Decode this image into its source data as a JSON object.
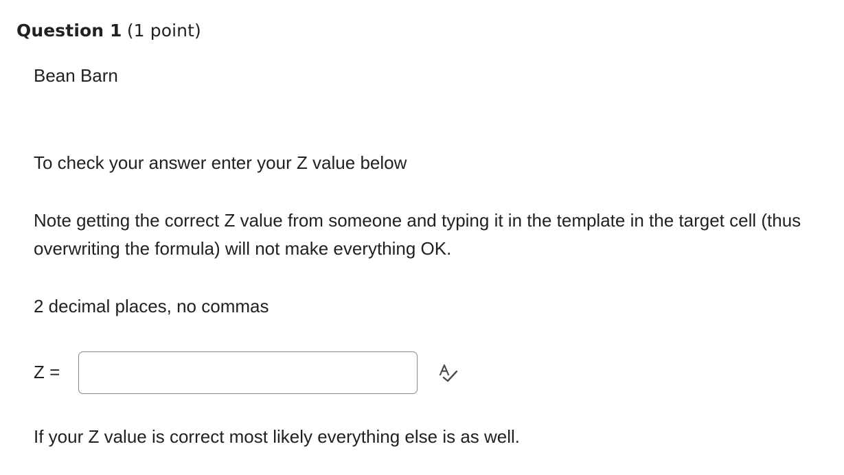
{
  "question": {
    "title": "Question 1",
    "points": "(1 point)"
  },
  "body": {
    "subject": "Bean Barn",
    "check_instruction": "To check your answer enter your Z value below",
    "note": "Note getting the correct Z value from someone and typing it in the template in the target cell (thus overwriting the formula) will not make everything OK.",
    "format_hint": "2 decimal places, no commas",
    "footer": "If your Z value is correct most likely everything else is as well."
  },
  "answer": {
    "label": "Z =",
    "value": "",
    "placeholder": "",
    "spellcheck_icon": "spellcheck-icon"
  },
  "colors": {
    "text": "#202122",
    "input_border": "#868686",
    "icon": "#494c4e"
  }
}
